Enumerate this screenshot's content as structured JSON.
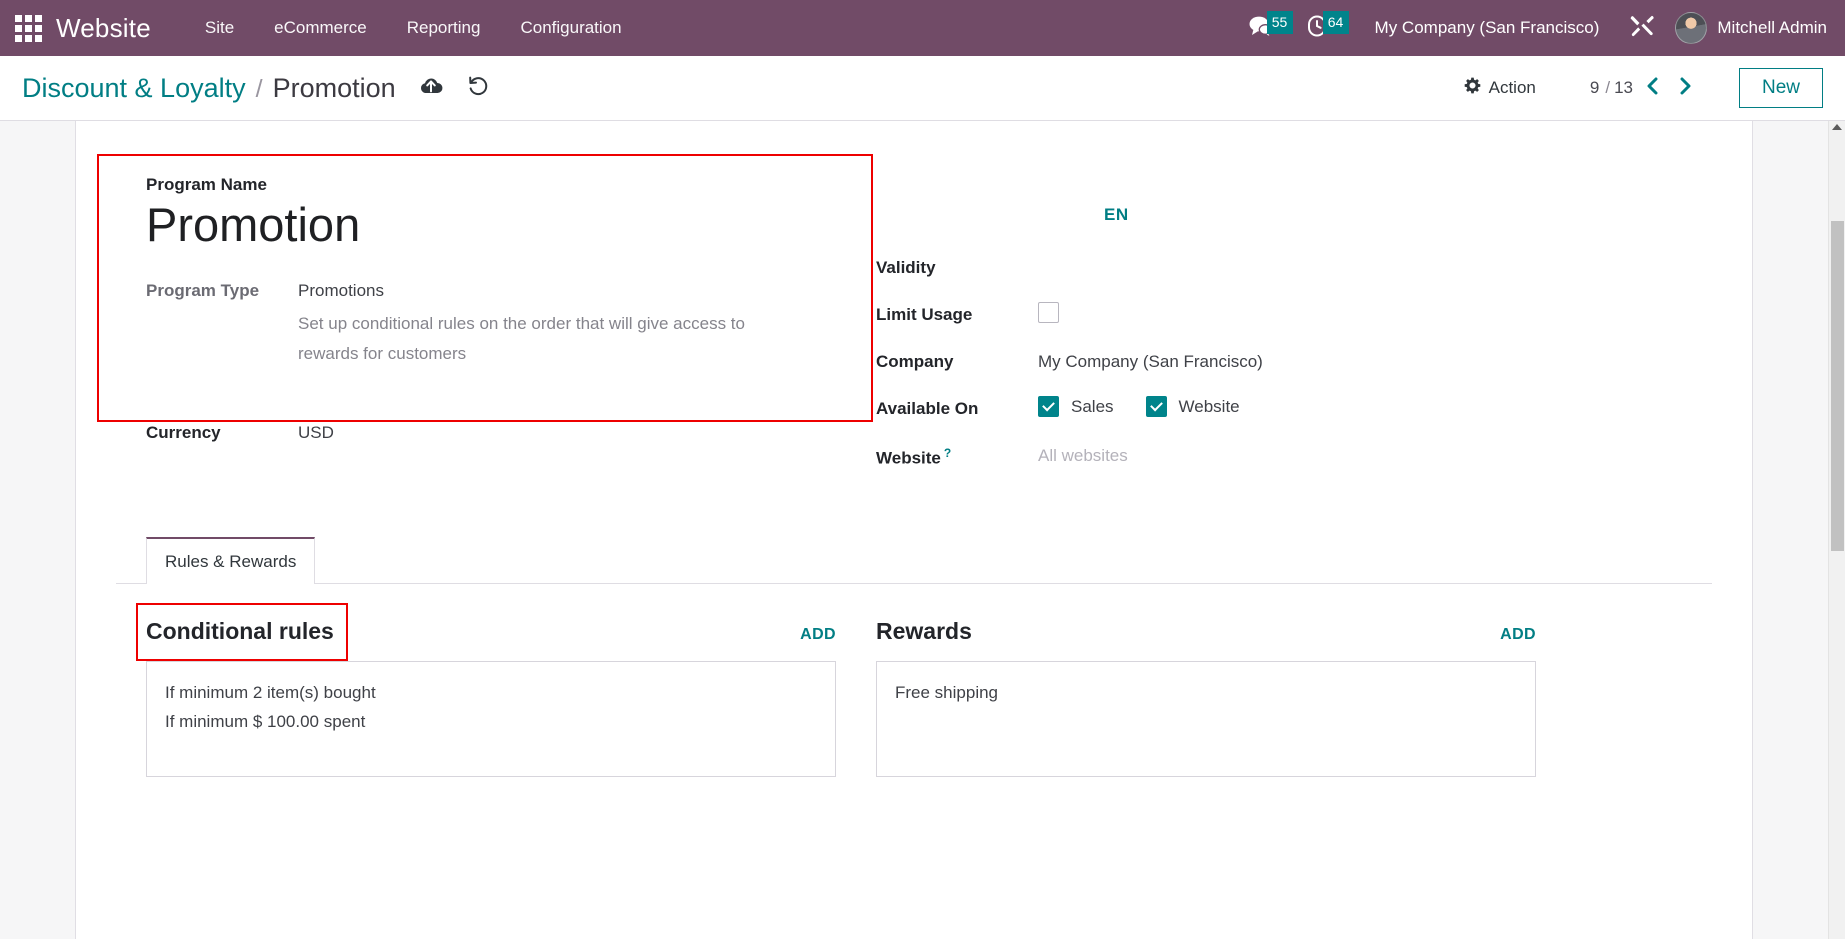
{
  "navbar": {
    "apps_icon": "apps-grid-icon",
    "brand": "Website",
    "menus": [
      {
        "label": "Site"
      },
      {
        "label": "eCommerce"
      },
      {
        "label": "Reporting"
      },
      {
        "label": "Configuration"
      }
    ],
    "messages": {
      "icon": "messages-icon",
      "count": "55"
    },
    "activities": {
      "icon": "clock-icon",
      "count": "64"
    },
    "company": "My Company (San Francisco)",
    "tools_icon": "developer-tools-icon",
    "user": "Mitchell Admin",
    "colors": {
      "bar": "#714B67",
      "badge": "#00848B"
    }
  },
  "control_panel": {
    "breadcrumb_parent": "Discount & Loyalty",
    "breadcrumb_separator": "/",
    "breadcrumb_current": "Promotion",
    "save_icon": "cloud-upload-icon",
    "discard_icon": "undo-discard-icon",
    "action_label": "Action",
    "action_icon": "gear-icon",
    "pager_value": "9",
    "pager_separator": "/",
    "pager_total": "13",
    "prev_icon": "chevron-left-icon",
    "next_icon": "chevron-right-icon",
    "new_label": "New",
    "accent": "#017E84"
  },
  "form": {
    "program_name_label": "Program Name",
    "program_name_value": "Promotion",
    "program_type_label": "Program Type",
    "program_type_value": "Promotions",
    "program_type_help": "Set up conditional rules on the order that will give access to rewards for customers",
    "currency_label": "Currency",
    "currency_value": "USD",
    "language_badge": "EN",
    "validity_label": "Validity",
    "validity_value": "",
    "limit_usage_label": "Limit Usage",
    "limit_usage_checked": false,
    "company_label": "Company",
    "company_value": "My Company (San Francisco)",
    "available_on_label": "Available On",
    "available_on": [
      {
        "label": "Sales",
        "checked": true
      },
      {
        "label": "Website",
        "checked": true
      }
    ],
    "website_label": "Website",
    "website_help_marker": "?",
    "website_placeholder": "All websites"
  },
  "notebook": {
    "tabs": [
      {
        "label": "Rules & Rewards",
        "active": true
      }
    ],
    "conditional_rules": {
      "title": "Conditional rules",
      "add_label": "ADD",
      "lines": [
        "If minimum 2 item(s) bought",
        "If minimum $ 100.00 spent"
      ]
    },
    "rewards": {
      "title": "Rewards",
      "add_label": "ADD",
      "lines": [
        "Free shipping"
      ]
    }
  },
  "annotations": {
    "program_box": "highlight-program-section",
    "tab_box": "highlight-rules-rewards-tab",
    "color": "#ee0000"
  }
}
